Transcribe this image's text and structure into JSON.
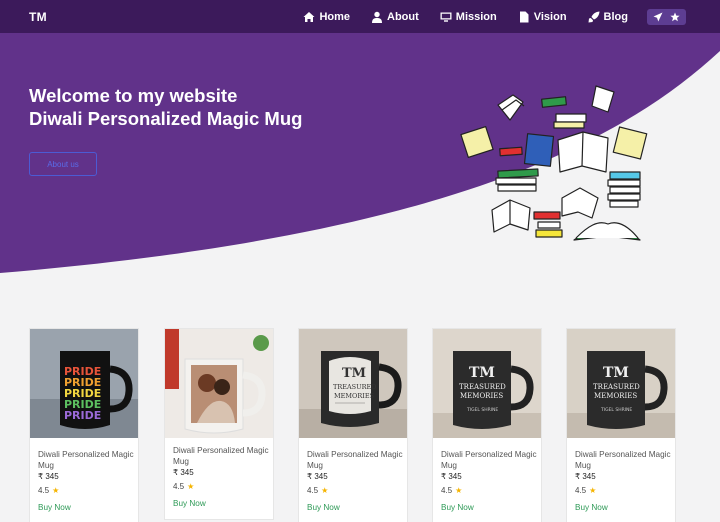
{
  "brand": "TM",
  "nav": {
    "items": [
      {
        "label": "Home",
        "icon": "home-icon"
      },
      {
        "label": "About",
        "icon": "user-icon"
      },
      {
        "label": "Mission",
        "icon": "monitor-icon"
      },
      {
        "label": "Vision",
        "icon": "document-icon"
      },
      {
        "label": "Blog",
        "icon": "rocket-icon"
      }
    ],
    "extra_icons": [
      "send-icon",
      "star-icon"
    ]
  },
  "hero": {
    "title_line1": "Welcome to my website",
    "title_line2": "Diwali Personalized Magic Mug",
    "button_label": "About us"
  },
  "colors": {
    "navbar": "#3c1a5b",
    "hero": "#61328a",
    "buy_link": "#2e9a57",
    "star": "#f5b400"
  },
  "products": [
    {
      "title": "Diwali Personalized Magic Mug",
      "price": "₹ 345",
      "rating": "4.5",
      "buy_label": "Buy Now",
      "image": "pride-mug"
    },
    {
      "title": "Diwali Personalized Magic Mug",
      "price": "₹ 345",
      "rating": "4.5",
      "buy_label": "Buy Now",
      "image": "photo-mug"
    },
    {
      "title": "Diwali Personalized Magic Mug",
      "price": "₹ 345",
      "rating": "4.5",
      "buy_label": "Buy Now",
      "image": "treasured-memories-mug"
    },
    {
      "title": "Diwali Personalized Magic Mug",
      "price": "₹ 345",
      "rating": "4.5",
      "buy_label": "Buy Now",
      "image": "treasured-memories-mug-dark"
    },
    {
      "title": "Diwali Personalized Magic Mug",
      "price": "₹ 345",
      "rating": "4.5",
      "buy_label": "Buy Now",
      "image": "treasured-memories-mug-dark"
    }
  ]
}
